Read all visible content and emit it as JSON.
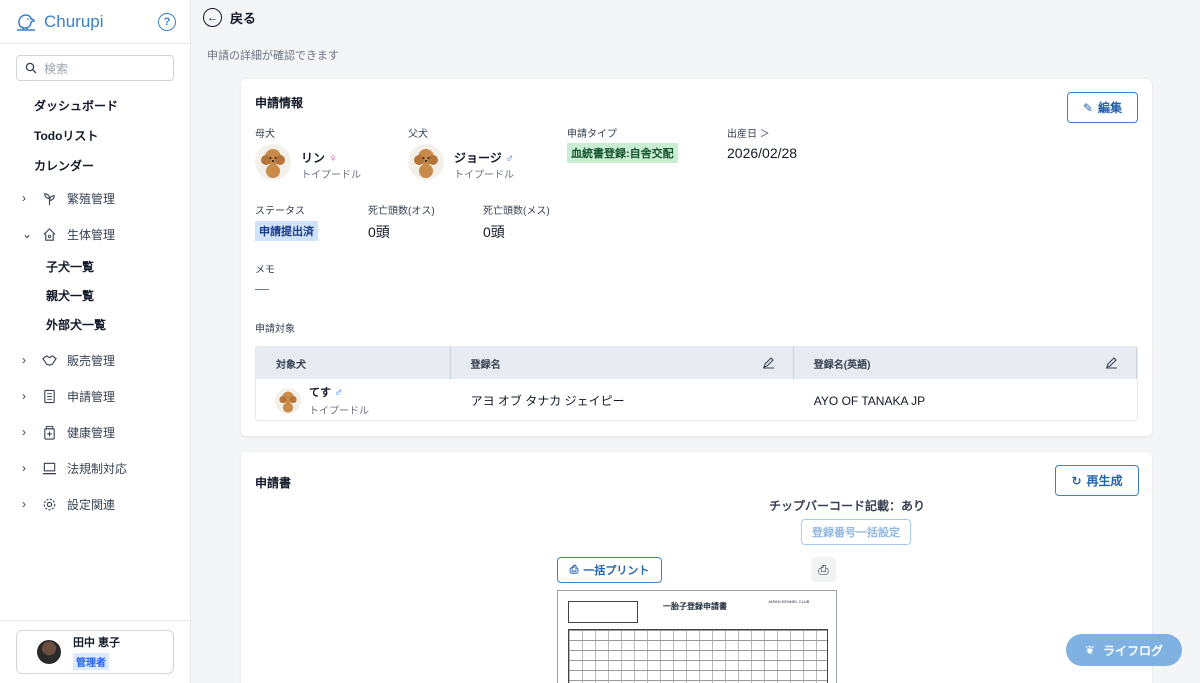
{
  "app": {
    "name": "Churupi",
    "help": "?"
  },
  "search": {
    "placeholder": "検索"
  },
  "nav_top": [
    "ダッシュボード",
    "Todoリスト",
    "カレンダー"
  ],
  "nav_groups": {
    "breeding": "繁殖管理",
    "biology": "生体管理",
    "sales": "販売管理",
    "application": "申請管理",
    "health": "健康管理",
    "legal": "法規制対応",
    "settings": "設定関連"
  },
  "biology_sub": [
    "子犬一覧",
    "親犬一覧",
    "外部犬一覧"
  ],
  "user": {
    "name": "田中 恵子",
    "role": "管理者"
  },
  "header": {
    "back": "戻る",
    "subtitle": "申請の詳細が確認できます"
  },
  "info": {
    "title": "申請情報",
    "edit": "編集",
    "mother_label": "母犬",
    "mother_name": "リン",
    "mother_sex": "♀",
    "mother_breed": "トイプードル",
    "father_label": "父犬",
    "father_name": "ジョージ",
    "father_sex": "♂",
    "father_breed": "トイプードル",
    "type_label": "申請タイプ",
    "type_value": "血統書登録:自舎交配",
    "birth_label": "出産日 ＞",
    "birth_value": "2026/02/28",
    "status_label": "ステータス",
    "status_value": "申請提出済",
    "dead_male_label": "死亡頭数(オス)",
    "dead_male_value": "0頭",
    "dead_female_label": "死亡頭数(メス)",
    "dead_female_value": "0頭",
    "memo_label": "メモ",
    "memo_value": "—",
    "targets_label": "申請対象"
  },
  "table": {
    "headers": [
      "対象犬",
      "登録名",
      "登録名(英語)"
    ],
    "row": {
      "name": "てす",
      "sex": "♂",
      "breed": "トイプードル",
      "reg_name": "アヨ オブ タナカ ジェイピー",
      "reg_name_en": "AYO OF TANAKA JP"
    }
  },
  "form": {
    "title": "申請書",
    "regenerate": "再生成",
    "chip": "チップバーコード記載：あり",
    "bulk_reg": "登録番号一括設定",
    "bulk_print": "一括プリント",
    "doc_title": "一胎子登録申請書",
    "doc_club": "JAPAN KENNEL CLUB"
  },
  "fab": {
    "label": "ライフログ"
  },
  "colors": {
    "accent": "#3b82c4",
    "green_tag": "#c9eed3",
    "blue_tag": "#cfe3fb"
  }
}
